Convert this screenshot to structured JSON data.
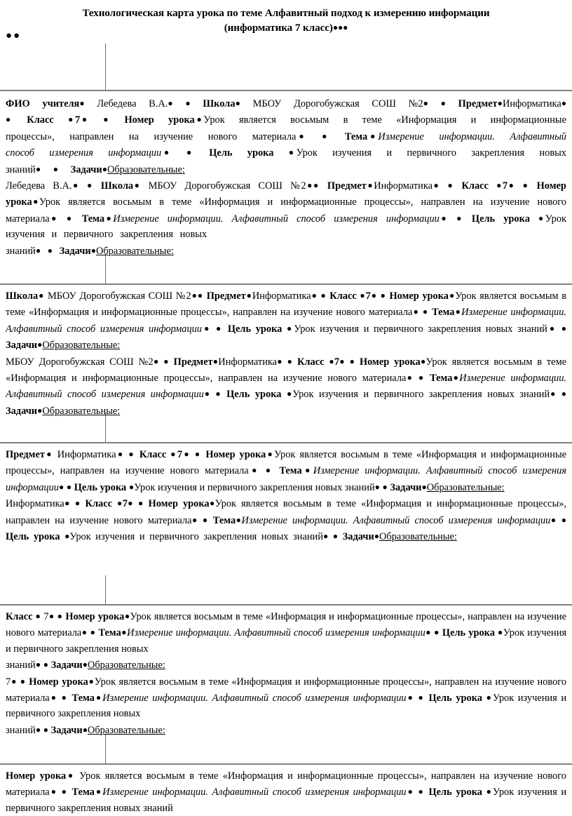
{
  "document": {
    "title_line1": "Технологическая карта урока по теме Алфавитный подход к измерению информации",
    "title_line2": "(информатика 7 класс)",
    "title_trailing_bullets": "●●●",
    "stray_bullets": "●●"
  },
  "labels": {
    "fio_uchitelya_a": "ФИО",
    "fio_uchitelya_b": "учителя",
    "shkola": "Школа",
    "predmet": "Предмет",
    "klass": "Класс",
    "nomer_uroka": "Номер урока",
    "tema": "Тема",
    "cel_uroka": "Цель урока",
    "zadachi": "Задачи",
    "obrazovatelnye": "Образовательные:"
  },
  "values": {
    "teacher": "Лебедева",
    "teacher_initials": "В.А.",
    "school": "МБОУ Дорогобужская СОШ",
    "school_number": "№2",
    "subject": "Информатика",
    "grade": "7",
    "lesson_number_text_1": "Урок является восьмым в теме «Информация и информационные процессы», направлен на изучение нового материала",
    "theme_italic": "Измерение информации. Алфавитный способ измерения информации",
    "theme_italic_part1": "Измерение информации.",
    "theme_italic_part2": "Алфавитный способ измерения",
    "theme_italic_part3": "информации",
    "goal_text": "Урок изучения и первичного закрепления новых знаний",
    "goal_text_a": "Урок изучения и первичного закрепления",
    "goal_text_b": "новых знаний",
    "goal_text_c": "Урок изучения и первичного закрепления новых",
    "goal_text_d": "знаний",
    "bullet": "●"
  },
  "blocks": [
    {
      "id": "block-fio",
      "start_label": "ФИО учителя",
      "paragraph_count": 2
    },
    {
      "id": "block-shkola",
      "start_label": "Школа",
      "paragraph_count": 2
    },
    {
      "id": "block-predmet",
      "start_label": "Предмет",
      "paragraph_count": 2
    },
    {
      "id": "block-klass",
      "start_label": "Класс",
      "paragraph_count": 2
    },
    {
      "id": "block-nomer",
      "start_label": "Номер урока",
      "paragraph_count": 1
    }
  ],
  "colors": {
    "rule": "#808080",
    "vertical_rule": "#707070",
    "text": "#000000",
    "background": "#ffffff"
  }
}
